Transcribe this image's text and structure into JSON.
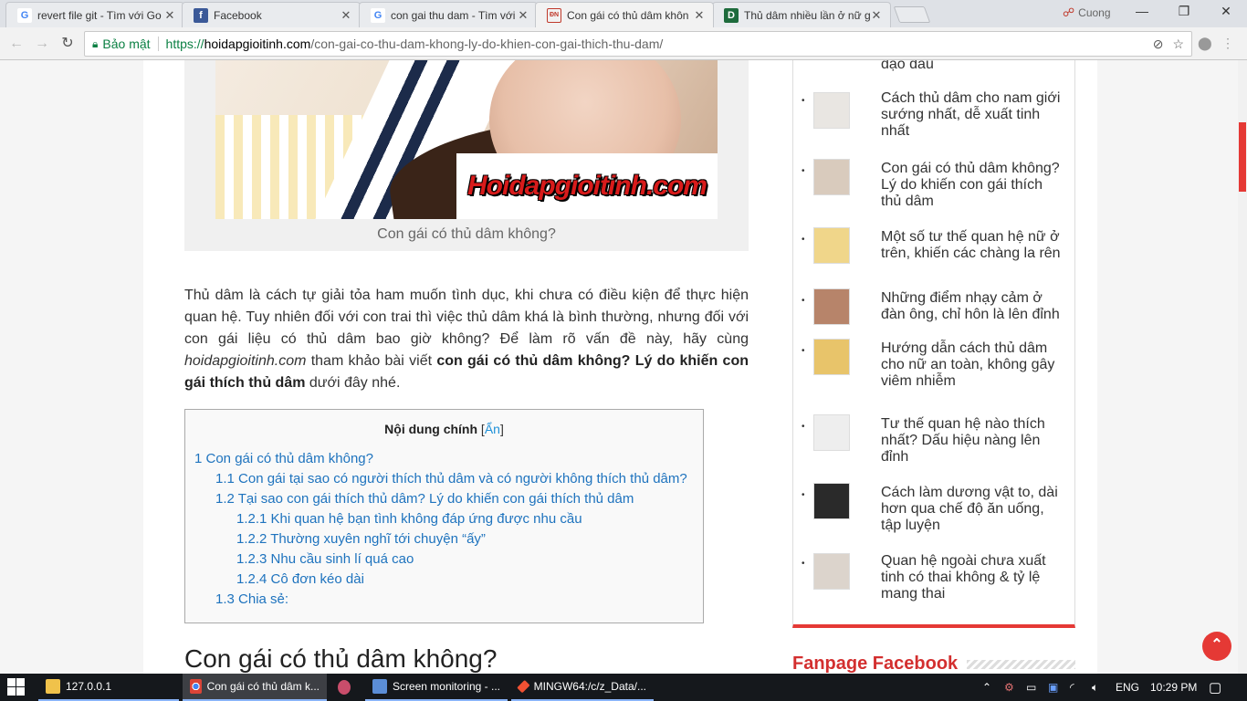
{
  "browser": {
    "tabs": [
      {
        "title": "revert file git - Tìm với Go",
        "favicon": "google-icon",
        "active": false
      },
      {
        "title": "Facebook",
        "favicon": "facebook-icon",
        "active": false
      },
      {
        "title": "con gai thu dam - Tìm với G",
        "favicon": "google-icon",
        "active": false
      },
      {
        "title": "Con gái có thủ dâm khôn",
        "favicon": "hoidap-icon",
        "active": true
      },
      {
        "title": "Thủ dâm nhiều lần ở nữ g",
        "favicon": "d-icon",
        "active": false
      }
    ],
    "profile_name": "Cuong",
    "secure_label": "Bảo mật",
    "url_scheme": "https://",
    "url_host": "hoidapgioitinh.com",
    "url_path": "/con-gai-co-thu-dam-khong-ly-do-khien-con-gai-thich-thu-dam/"
  },
  "article": {
    "image_caption": "Con gái có thủ dâm không?",
    "image_logo_text": "Hoidapgioitinh.com",
    "intro_part1": "Thủ dâm là cách tự giải tỏa ham muốn tình dục, khi chưa có điều kiện để thực hiện quan hệ. Tuy nhiên đối với con trai thì việc thủ dâm khá là bình thường, nhưng đối với con gái liệu có thủ dâm bao giờ không? Để làm rõ vấn đề này, hãy cùng ",
    "intro_site": "hoidapgioitinh.com",
    "intro_part2": " tham khảo bài viết ",
    "intro_bold": "con gái có thủ dâm không? Lý do khiến con gái thích thủ dâm",
    "intro_part3": " dưới đây nhé.",
    "toc": {
      "title": "Nội dung chính",
      "toggle_open": "[",
      "toggle_label": "Ẩn",
      "toggle_close": "]",
      "items": [
        {
          "level": 1,
          "text": "1 Con gái có thủ dâm không?"
        },
        {
          "level": 2,
          "text": "1.1 Con gái tại sao có người thích thủ dâm và có người không thích thủ dâm?"
        },
        {
          "level": 2,
          "text": "1.2 Tại sao con gái thích thủ dâm? Lý do khiến con gái thích thủ dâm"
        },
        {
          "level": 3,
          "text": "1.2.1 Khi quan hệ bạn tình không đáp ứng được nhu cầu"
        },
        {
          "level": 3,
          "text": "1.2.2 Thường xuyên nghĩ tới chuyện “ấy”"
        },
        {
          "level": 3,
          "text": "1.2.3 Nhu cầu sinh lí quá cao"
        },
        {
          "level": 3,
          "text": "1.2.4 Cô đơn kéo dài"
        },
        {
          "level": 2,
          "text": "1.3 Chia sẻ:"
        }
      ]
    },
    "section_heading": "Con gái có thủ dâm không?"
  },
  "sidebar": {
    "top_fragment": "đạo dâu",
    "items": [
      {
        "text": "Cách thủ dâm cho nam giới sướng nhất, dễ xuất tinh nhất",
        "thumb": "#e9e6e2"
      },
      {
        "text": "Con gái có thủ dâm không? Lý do khiến con gái thích thủ dâm",
        "thumb": "#d9cbbd"
      },
      {
        "text": "Một số tư thế quan hệ nữ ở trên, khiến các chàng la rên",
        "thumb": "#f0d68a"
      },
      {
        "text": "Những điểm nhạy cảm ở đàn ông, chỉ hôn là lên đỉnh",
        "thumb": "#b7846a"
      },
      {
        "text": "Hướng dẫn cách thủ dâm cho nữ an toàn, không gây viêm nhiễm",
        "thumb": "#e8c46a"
      },
      {
        "text": "Tư thế quan hệ nào thích nhất? Dấu hiệu nàng lên đỉnh",
        "thumb": "#eeeeee"
      },
      {
        "text": "Cách làm dương vật to, dài hơn qua chế độ ăn uống, tập luyện",
        "thumb": "#2a2a2a"
      },
      {
        "text": "Quan hệ ngoài chưa xuất tinh có thai không & tỷ lệ mang thai",
        "thumb": "#dcd4cc"
      }
    ],
    "fanpage_title": "Fanpage Facebook"
  },
  "taskbar": {
    "items": [
      {
        "label": "127.0.0.1",
        "icon": "folder-icon"
      },
      {
        "label": "Con gái có thủ dâm k...",
        "icon": "chrome-icon"
      },
      {
        "label": "",
        "icon": "app-icon"
      },
      {
        "label": "Screen monitoring - ...",
        "icon": "monitor-app-icon"
      },
      {
        "label": "MINGW64:/c/z_Data/...",
        "icon": "git-bash-icon"
      }
    ],
    "language": "ENG",
    "time": "10:29 PM"
  }
}
